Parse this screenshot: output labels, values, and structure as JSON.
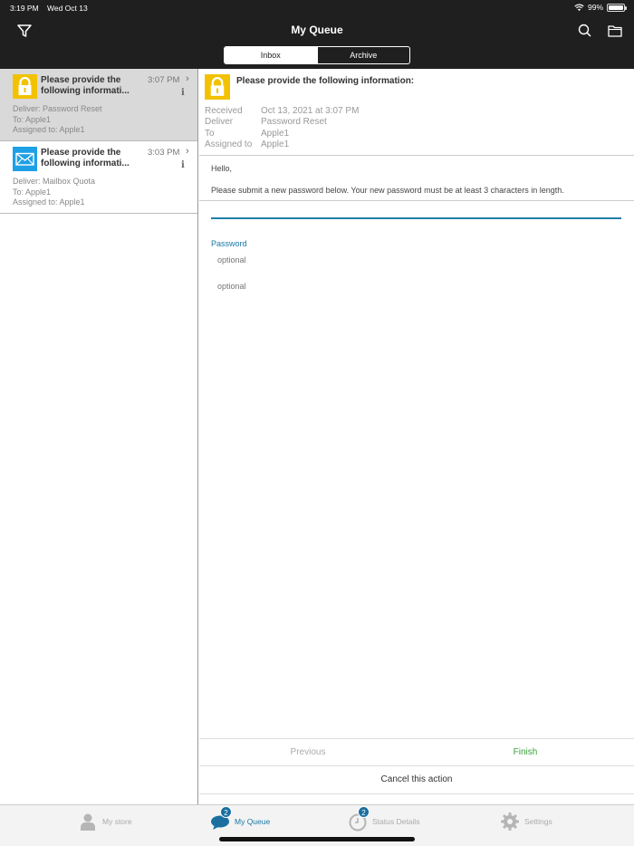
{
  "status_bar": {
    "time": "3:19 PM",
    "date": "Wed Oct 13",
    "battery": "99%"
  },
  "header": {
    "title": "My Queue",
    "segments": [
      "Inbox",
      "Archive"
    ],
    "selected_segment": "Inbox",
    "icons": {
      "filter": "filter-icon",
      "search": "search-icon",
      "folder": "folder-icon"
    }
  },
  "queue": {
    "items": [
      {
        "icon": "lock-icon",
        "subject": "Please provide the following informati...",
        "time": "3:07 PM",
        "info": "i",
        "deliver": "Deliver: Password Reset",
        "to": "To: Apple1",
        "assigned": "Assigned to: Apple1",
        "selected": true
      },
      {
        "icon": "mail-icon",
        "subject": "Please provide the following informati...",
        "time": "3:03 PM",
        "info": "i",
        "deliver": "Deliver: Mailbox Quota",
        "to": "To: Apple1",
        "assigned": "Assigned to: Apple1",
        "selected": false
      }
    ]
  },
  "detail": {
    "subject": "Please provide the following information:",
    "received_label": "Received",
    "received_value": "Oct 13, 2021 at 3:07 PM",
    "deliver_label": "Deliver",
    "deliver_value": "Password Reset",
    "to_label": "To",
    "to_value": "Apple1",
    "assigned_label": "Assigned to",
    "assigned_value": "Apple1",
    "greeting": "Hello,",
    "message": "Please submit a new password below. Your new password must be at least 3 characters in length.",
    "password_label": "Password",
    "password_placeholder": "optional",
    "confirm_placeholder": "optional",
    "previous": "Previous",
    "finish": "Finish",
    "cancel": "Cancel this action"
  },
  "tabbar": {
    "tabs": [
      {
        "label": "My store",
        "icon": "person-icon",
        "badge": ""
      },
      {
        "label": "My Queue",
        "icon": "chat-bubble-icon",
        "badge": "2"
      },
      {
        "label": "Status Details",
        "icon": "clock-icon",
        "badge": "2"
      },
      {
        "label": "Settings",
        "icon": "gear-icon",
        "badge": ""
      }
    ],
    "active": "My Queue"
  },
  "colors": {
    "accent": "#1a77a6",
    "finish": "#3aa23a",
    "header_bg": "#1f1f1f",
    "lock_yellow": "#f2c200",
    "mail_blue": "#1ea0e6"
  }
}
